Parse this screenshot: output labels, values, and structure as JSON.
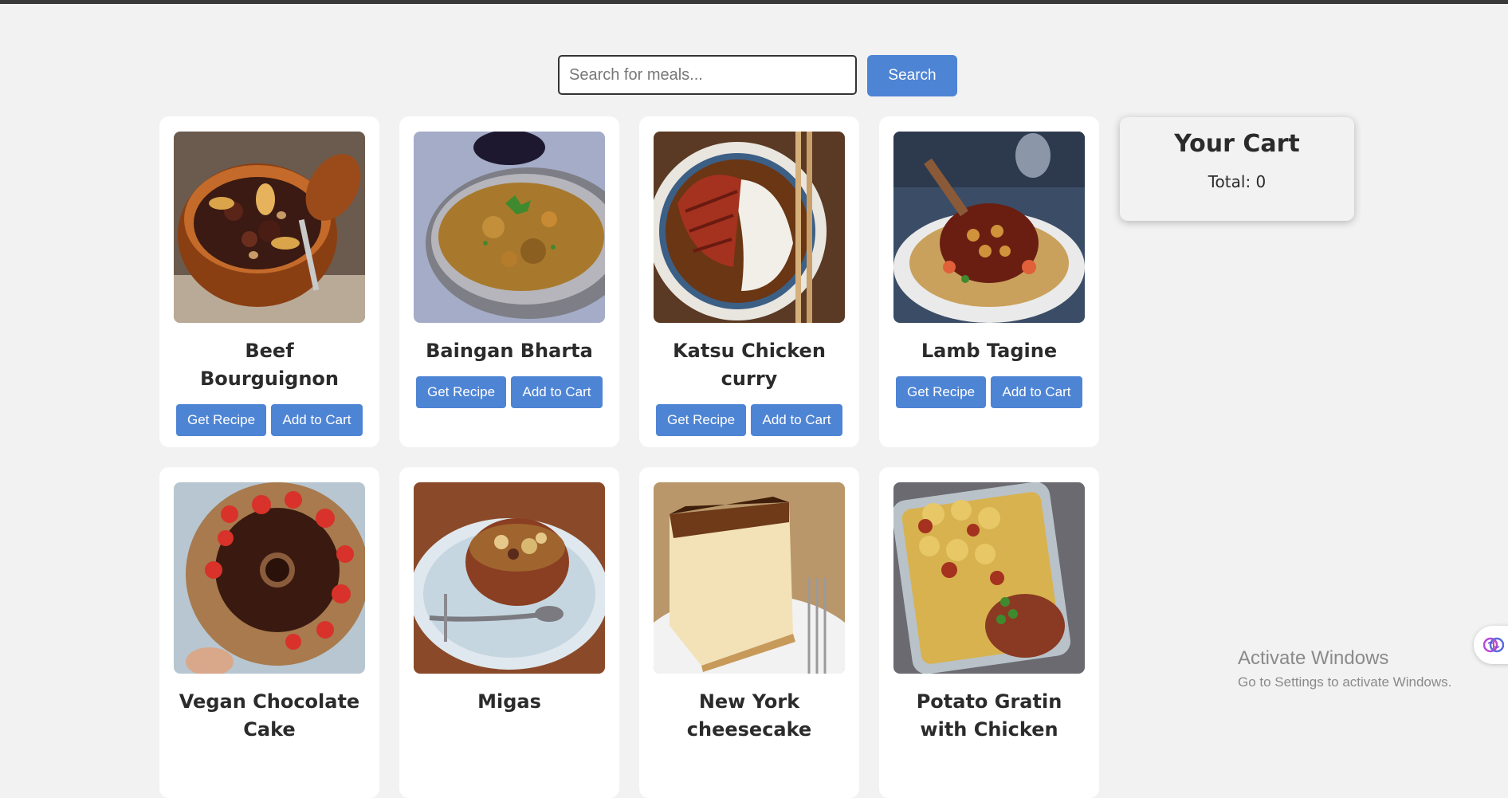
{
  "search": {
    "placeholder": "Search for meals...",
    "button_label": "Search"
  },
  "meals": [
    {
      "title": "Beef Bourguignon",
      "recipe_label": "Get Recipe",
      "cart_label": "Add to Cart",
      "image": "beef-bourguignon-photo"
    },
    {
      "title": "Baingan Bharta",
      "recipe_label": "Get Recipe",
      "cart_label": "Add to Cart",
      "image": "baingan-bharta-photo"
    },
    {
      "title": "Katsu Chicken curry",
      "recipe_label": "Get Recipe",
      "cart_label": "Add to Cart",
      "image": "katsu-chicken-curry-photo"
    },
    {
      "title": "Lamb Tagine",
      "recipe_label": "Get Recipe",
      "cart_label": "Add to Cart",
      "image": "lamb-tagine-photo"
    },
    {
      "title": "Vegan Chocolate Cake",
      "image": "vegan-chocolate-cake-photo"
    },
    {
      "title": "Migas",
      "image": "migas-photo"
    },
    {
      "title": "New York cheesecake",
      "image": "new-york-cheesecake-photo"
    },
    {
      "title": "Potato Gratin with Chicken",
      "image": "potato-gratin-photo"
    }
  ],
  "cart": {
    "title": "Your Cart",
    "total_label": "Total: 0"
  },
  "watermark": {
    "title": "Activate Windows",
    "subtitle": "Go to Settings to activate Windows."
  },
  "colors": {
    "accent": "#4e84d4",
    "background": "#f2f2f2",
    "card": "#ffffff",
    "text": "#2b2b2b"
  },
  "icons": {
    "floating_widget": "brain-icon"
  }
}
